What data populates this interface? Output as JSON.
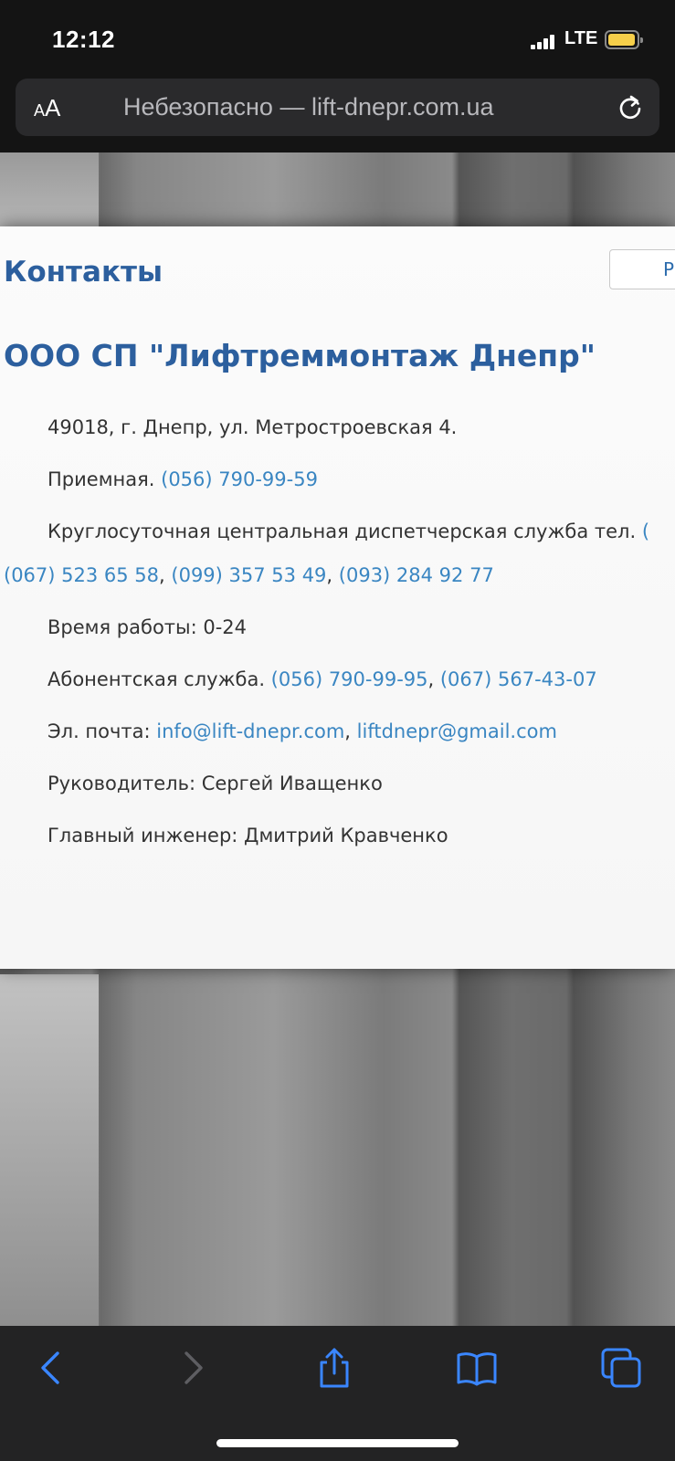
{
  "status_bar": {
    "time": "12:12",
    "network": "LTE",
    "battery_color": "#f6cf4a"
  },
  "browser": {
    "text_size_button": "AA",
    "url_display": "Небезопасно — lift-dnepr.com.ua",
    "reload_icon": "reload-icon"
  },
  "page": {
    "heading": "Контакты",
    "side_box_label": "Р",
    "company": "ООО СП \"Лифтреммонтаж Днепр\"",
    "address": "49018, г. Днепр, ул. Метростроевская 4.",
    "reception": {
      "label": "Приемная. ",
      "phone": "(056) 790-99-59"
    },
    "dispatch": {
      "label": "Круглосуточная центральная диспетчерская служба тел. ",
      "cut_text": "(",
      "phone1": "(067) 523 65 58",
      "sep1": ", ",
      "phone2": "(099) 357 53 49",
      "sep2": ", ",
      "phone3": "(093) 284 92 77"
    },
    "hours": "Время работы: 0-24",
    "subscriber": {
      "label": "Абонентская служба. ",
      "phone1": "(056) 790-99-95",
      "sep": ", ",
      "phone2": "(067) 567-43-07"
    },
    "email": {
      "label": "Эл. почта: ",
      "email1": "info@lift-dnepr.com",
      "sep": ", ",
      "email2": "liftdnepr@gmail.com"
    },
    "director": "Руководитель: Сергей Иващенко",
    "chief_engineer": "Главный инженер: Дмитрий Кравченко",
    "heading_color": "#2c5f9e",
    "link_color": "#3a86c2"
  },
  "toolbar": {
    "back_icon": "back-icon",
    "forward_icon": "forward-icon",
    "share_icon": "share-icon",
    "bookmarks_icon": "bookmarks-icon",
    "tabs_icon": "tabs-icon",
    "accent": "#3a86ff"
  }
}
